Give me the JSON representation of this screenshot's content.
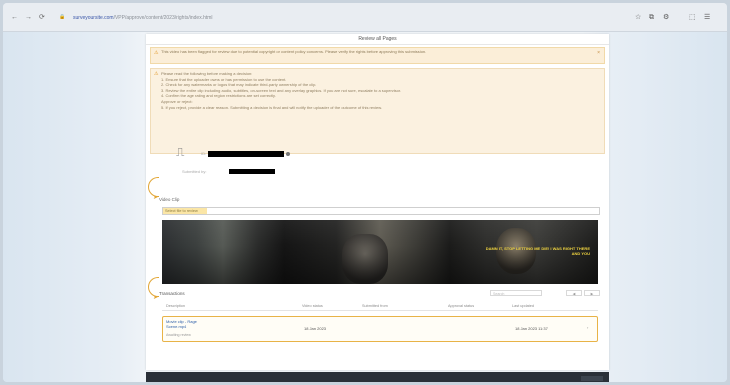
{
  "browser": {
    "url_host": "surveyoursite.com",
    "url_path": "/VPP/approve/content/2023/rights/index.html",
    "nav": {
      "back": "←",
      "forward": "→",
      "reload": "⟳",
      "lock": "🔒"
    },
    "tools": [
      "☆",
      "⧉",
      "⚙",
      "⬚",
      "☰"
    ]
  },
  "modal": {
    "title": "Review all Pages",
    "alert_banner": "This video has been flagged for review due to potential copyright or content policy concerns. Please verify the rights before approving this submission.",
    "close_glyph": "×",
    "info_panel": {
      "lines": [
        "Please read the following before making a decision:",
        "1. Ensure that the uploader owns or has permission to use the content.",
        "2. Check for any watermarks or logos that may indicate third-party ownership of the clip.",
        "3. Review the entire clip including audio, subtitles, on-screen text and any overlay graphics. If you are not sure, escalate to a supervisor.",
        "4. Confirm the age rating and region restrictions are set correctly.",
        "Approve or reject:",
        "5. If you reject, provide a clear reason. Submitting a decision is final and will notify the uploader of the outcome of this review."
      ]
    },
    "user": {
      "name_prefix": "ID:",
      "line2_prefix": "Submitted by:"
    },
    "video_section": {
      "label": "Video Clip",
      "input_tag": "Select file to review",
      "subtitle_text": "DAMN IT, STOP LETTING ME DIE! I WAS RIGHT THERE AND YOU"
    },
    "table": {
      "title": "Transactions",
      "search_placeholder": "Search",
      "buttons": [
        "◀",
        "▶"
      ],
      "headers": [
        "Description",
        "Video status",
        "Submitted from",
        "Approval status",
        "Last updated"
      ],
      "row": {
        "title_line1": "Movie clip - Rage",
        "title_line2": "Scene.mp4",
        "subline": "Awaiting review",
        "status": "18 Jan 2023",
        "date": "18 Jan 2023 11:37",
        "chevron": "›"
      }
    }
  },
  "colors": {
    "highlight": "#e8b347",
    "warning_bg": "#fbeed8"
  }
}
